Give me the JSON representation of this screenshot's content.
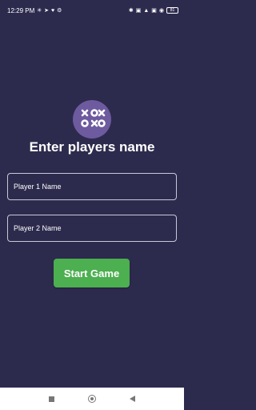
{
  "status_bar": {
    "time": "12:29 PM",
    "battery": "81",
    "left_icons": [
      "sync-icon",
      "navigation-icon",
      "wifi-calling-icon",
      "settings-icon"
    ],
    "right_icons": [
      "bluetooth-icon",
      "sim-icon",
      "signal-icon",
      "wifi-icon",
      "battery-icon"
    ]
  },
  "main": {
    "title": "Enter players name",
    "player1_placeholder": "Player 1 Name",
    "player2_placeholder": "Player 2 Name",
    "start_label": "Start Game"
  },
  "colors": {
    "background": "#2d2b4d",
    "logo_bg": "#6e5a9e",
    "button": "#4caf50"
  }
}
